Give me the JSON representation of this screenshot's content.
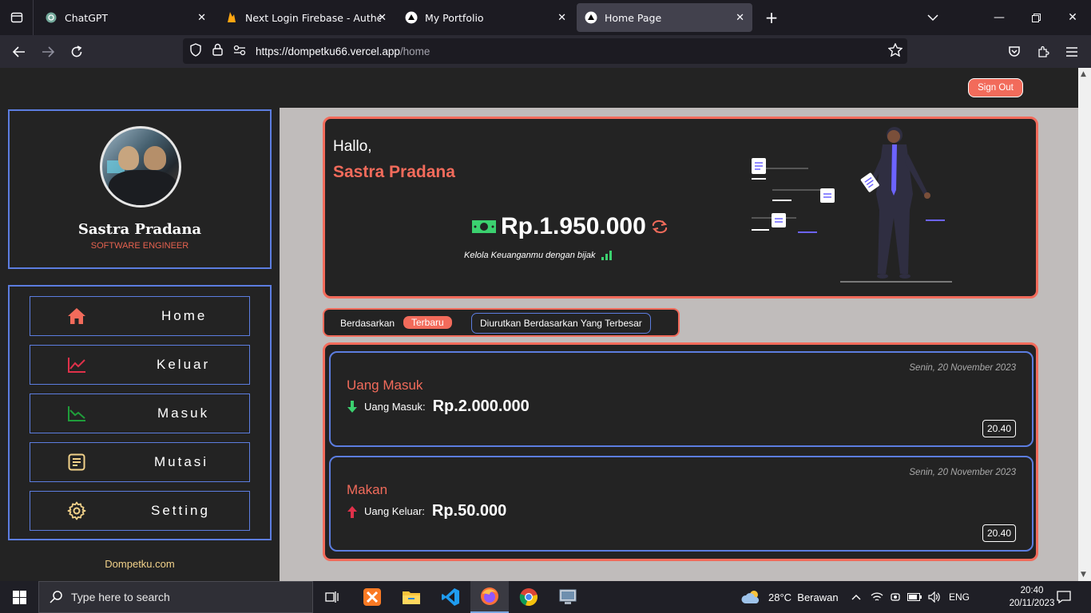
{
  "browser": {
    "tabs": [
      {
        "label": "ChatGPT",
        "icon": "chatgpt-icon"
      },
      {
        "label": "Next Login Firebase - Authentic",
        "icon": "firebase-icon"
      },
      {
        "label": "My Portfolio",
        "icon": "vercel-icon"
      },
      {
        "label": "Home Page",
        "icon": "vercel-icon",
        "active": true
      }
    ],
    "url": {
      "host": "https://dompetku66.vercel.app",
      "path": "/home"
    }
  },
  "sidebar": {
    "name": "Sastra Pradana",
    "role": "SOFTWARE ENGINEER",
    "menu": [
      {
        "label": "Home",
        "icon": "home-icon",
        "color": "#f26b5b"
      },
      {
        "label": "Keluar",
        "icon": "chart-up-icon",
        "color": "#e0314a"
      },
      {
        "label": "Masuk",
        "icon": "chart-down-icon",
        "color": "#1f9d3a"
      },
      {
        "label": "Mutasi",
        "icon": "document-icon",
        "color": "#f2d28a"
      },
      {
        "label": "Setting",
        "icon": "gear-icon",
        "color": "#f2d28a"
      }
    ],
    "footer": "Dompetku.com"
  },
  "header": {
    "signout_label": "Sign Out"
  },
  "hero": {
    "greeting": "Hallo,",
    "name": "Sastra Pradana",
    "balance": "Rp.1.950.000",
    "tagline": "Kelola Keuanganmu dengan bijak"
  },
  "filter": {
    "label": "Berdasarkan",
    "chip": "Terbaru",
    "sort_button": "Diurutkan Berdasarkan Yang Terbesar"
  },
  "transactions": [
    {
      "date": "Senin, 20 November 2023",
      "title": "Uang Masuk",
      "kind": "Uang Masuk:",
      "amount": "Rp.2.000.000",
      "time": "20.40",
      "direction": "in"
    },
    {
      "date": "Senin, 20 November 2023",
      "title": "Makan",
      "kind": "Uang Keluar:",
      "amount": "Rp.50.000",
      "time": "20.40",
      "direction": "out"
    }
  ],
  "taskbar": {
    "search_placeholder": "Type here to search",
    "weather": "28°C  Berawan",
    "lang": "ENG",
    "time": "20:40",
    "date": "20/11/2023"
  },
  "colors": {
    "accent": "#f26b5b",
    "border_blue": "#5c7de0",
    "panel": "#232323"
  }
}
